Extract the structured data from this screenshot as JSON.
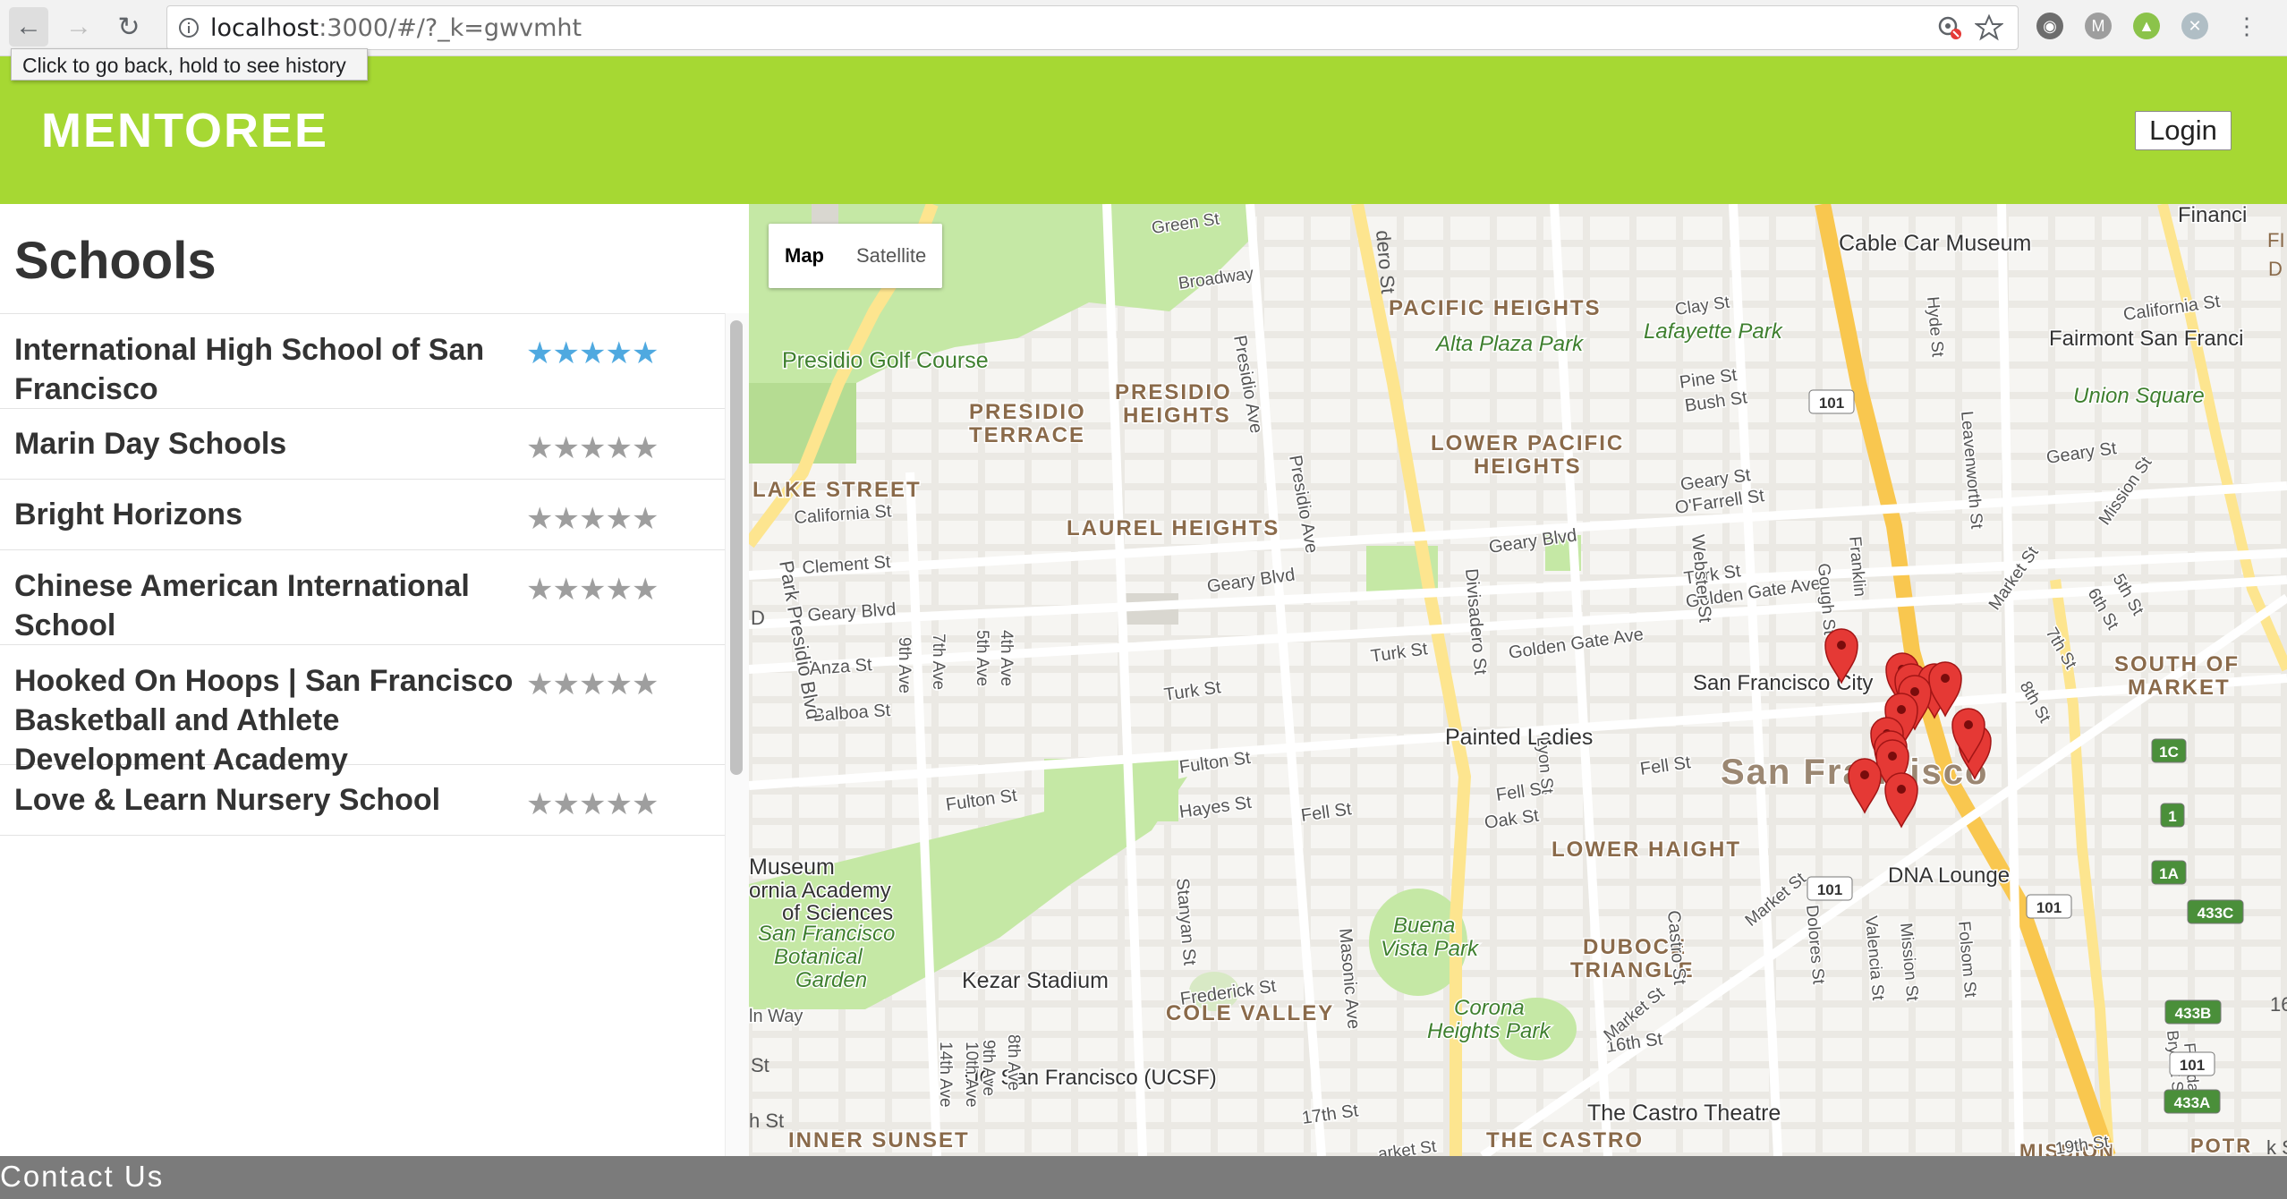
{
  "browser": {
    "url_host": "localhost",
    "url_rest": ":3000/#/?_k=gwvmht",
    "tooltip": "Click to go back, hold to see history",
    "extension_letter": "M"
  },
  "app": {
    "brand": "MENTOREE",
    "login_label": "Login"
  },
  "sidebar": {
    "title": "Schools",
    "schools": [
      {
        "name": "International High School of San Francisco",
        "rating": 5,
        "lines": 2
      },
      {
        "name": "Marin Day Schools",
        "rating": 0,
        "lines": 1
      },
      {
        "name": "Bright Horizons",
        "rating": 0,
        "lines": 1
      },
      {
        "name": "Chinese American International School",
        "rating": 0,
        "lines": 2
      },
      {
        "name": "Hooked On Hoops | San Francisco Basketball and Athlete Development Academy",
        "rating": 0,
        "lines": 3
      },
      {
        "name": "Love & Learn Nursery School",
        "rating": 0,
        "lines": 1
      }
    ]
  },
  "map": {
    "toggle_map": "Map",
    "toggle_satellite": "Satellite",
    "labels": {
      "cable_car": "Cable Car Museum",
      "financial": "Financi",
      "pacific_heights": "PACIFIC HEIGHTS",
      "alta_plaza": "Alta Plaza Park",
      "lafayette": "Lafayette Park",
      "fairmont": "Fairmont San Franci",
      "union_square": "Union Square",
      "presidio_golf": "Presidio Golf Course",
      "presidio_terrace_1": "PRESIDIO",
      "presidio_terrace_2": "TERRACE",
      "presidio_heights_1": "PRESIDIO",
      "presidio_heights_2": "HEIGHTS",
      "lower_pac_1": "LOWER PACIFIC",
      "lower_pac_2": "HEIGHTS",
      "lake_street": "LAKE STREET",
      "laurel_heights": "LAUREL HEIGHTS",
      "south_market_1": "SOUTH OF",
      "south_market_2": "MARKET",
      "sf_city": "San Francisco City",
      "painted_ladies": "Painted Ladies",
      "san_francisco": "San Francisco",
      "lower_haight": "LOWER HAIGHT",
      "museum": "Museum",
      "academy_1": "ornia Academy",
      "academy_2": "of Sciences",
      "botanical_1": "San Francisco",
      "botanical_2": "Botanical",
      "botanical_3": "Garden",
      "dna": "DNA Lounge",
      "buena_1": "Buena",
      "buena_2": "Vista Park",
      "duboce_1": "DUBOCE",
      "duboce_2": "TRIANGLE",
      "kezar": "Kezar Stadium",
      "corona_1": "Corona",
      "corona_2": "Heights Park",
      "cole_valley": "COLE VALLEY",
      "ucsf": "UC San Francisco (UCSF)",
      "castro_theatre": "The Castro Theatre",
      "inner_sunset": "INNER SUNSET",
      "the_castro": "THE CASTRO",
      "mission": "MISSION",
      "potr": "POTR",
      "green_st": "Green St",
      "broadway": "Broadway",
      "clay_st": "Clay St",
      "california_st": "California St",
      "california_st_e": "California St",
      "pine_st": "Pine St",
      "bush_st": "Bush St",
      "geary_st": "Geary St",
      "ofarrell": "O'Farrell St",
      "geary_st_e": "Geary St",
      "turk_st_e": "Turk St",
      "golden_gate_e": "Golden Gate Ave",
      "clement": "Clement St",
      "geary_blvd_w": "Geary Blvd",
      "geary_blvd_c": "Geary Blvd",
      "geary_blvd_e": "Geary Blvd",
      "anza": "Anza St",
      "balboa": "Balboa St",
      "turk_st_w": "Turk St",
      "turk_st_c": "Turk St",
      "golden_gate_c": "Golden Gate Ave",
      "fulton_c": "Fulton St",
      "fulton_w": "Fulton St",
      "hayes": "Hayes St",
      "fell_c": "Fell St",
      "fell_e": "Fell St",
      "fell_e2": "Fell St",
      "oak": "Oak St",
      "frederick": "Frederick St",
      "lin_way": "ln Way",
      "st_16": "16th St",
      "st_17": "17th St",
      "st_19": "19th St",
      "market_st_e": "Market St",
      "arket_st": "arket St",
      "park_presidio": "Park Presidio Blvd",
      "presidio_ave": "Presidio Ave",
      "presidio_ave2": "Presidio Ave",
      "ave_9": "9th Ave",
      "ave_7": "7th Ave",
      "ave_5": "5th Ave",
      "ave_4": "4th Ave",
      "divisadero": "Divisadero St",
      "webster": "Webster St",
      "gough": "Gough St",
      "franklin": "Franklin",
      "hyde": "Hyde St",
      "leavenworth": "Leavenworth St",
      "lyon": "Lyon St",
      "stanyan": "Stanyan St",
      "masonic": "Masonic Ave",
      "castro_st": "Castro St",
      "dolores": "Dolores St",
      "valencia": "Valencia St",
      "mission_st": "Mission St",
      "folsom": "Folsom St",
      "bryant": "Bryant St",
      "florida": "Florida St",
      "st_8": "8th St",
      "st_7": "7th St",
      "st_6": "6th St",
      "st_5": "5th St",
      "market_st_ne": "Market St",
      "mission_st_ne": "Mission St",
      "ave_14": "14th Ave",
      "ave_10": "10th Ave",
      "ave_9b": "9th Ave",
      "ave_8": "8th Ave",
      "hwy_101": "101",
      "hwy_1": "1",
      "hwy_1c": "1C",
      "hwy_1a": "1A",
      "hwy_433c": "433C",
      "hwy_433b": "433B",
      "hwy_433a": "433A",
      "fi": "FI",
      "d": "D",
      "edge_d": "D",
      "edge_st": "St",
      "edge_hst": "h St",
      "edge_16": "16",
      "edge_ero": "dero St",
      "edge_ks": "k St"
    },
    "marker_count": 14
  },
  "footer": {
    "text": "Contact Us"
  },
  "colors": {
    "brand_green": "#a6d833",
    "star_active": "#4fa9e0",
    "star_inactive": "#9e9e9e",
    "marker_red": "#e53935",
    "park_green": "#c5e8a5",
    "footer_gray": "#7b7b7b"
  }
}
